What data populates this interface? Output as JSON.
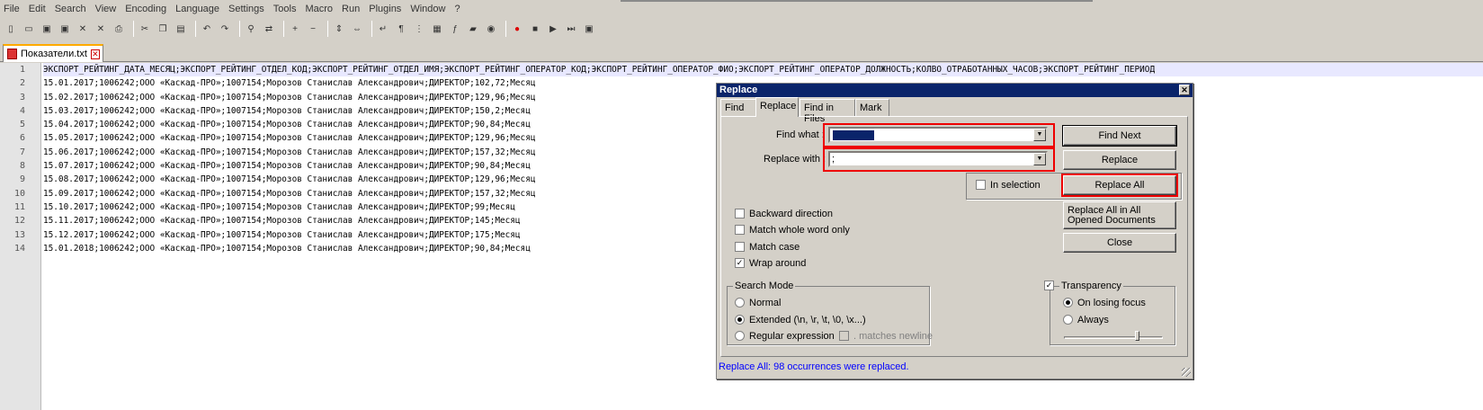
{
  "menu": [
    "File",
    "Edit",
    "Search",
    "View",
    "Encoding",
    "Language",
    "Settings",
    "Tools",
    "Macro",
    "Run",
    "Plugins",
    "Window",
    "?"
  ],
  "toolbar": {
    "icons": [
      "new-file-icon",
      "open-file-icon",
      "save-icon",
      "save-all-icon",
      "close-icon",
      "close-all-icon",
      "print-icon",
      "cut-icon",
      "copy-icon",
      "paste-icon",
      "undo-icon",
      "redo-icon",
      "find-icon",
      "replace-icon",
      "zoom-in-icon",
      "zoom-out-icon",
      "sync-v-icon",
      "sync-h-icon",
      "wrap-icon",
      "show-all-icon",
      "indent-guide-icon",
      "doc-map-icon",
      "function-list-icon",
      "folder-icon",
      "monitor-icon",
      "record-icon",
      "stop-icon",
      "play-icon",
      "run-multiple-icon",
      "save-macro-icon"
    ]
  },
  "tab": {
    "label": "Показатели.txt"
  },
  "editor": {
    "lines": [
      "ЭКСПОРТ_РЕЙТИНГ_ДАТА_МЕСЯЦ;ЭКСПОРТ_РЕЙТИНГ_ОТДЕЛ_КОД;ЭКСПОРТ_РЕЙТИНГ_ОТДЕЛ_ИМЯ;ЭКСПОРТ_РЕЙТИНГ_ОПЕРАТОР_КОД;ЭКСПОРТ_РЕЙТИНГ_ОПЕРАТОР_ФИО;ЭКСПОРТ_РЕЙТИНГ_ОПЕРАТОР_ДОЛЖНОСТЬ;КОЛВО_ОТРАБОТАННЫХ_ЧАСОВ;ЭКСПОРТ_РЕЙТИНГ_ПЕРИОД",
      "15.01.2017;1006242;ООО «Каскад-ПРО»;1007154;Морозов Станислав Александрович;ДИРЕКТОР;102,72;Месяц",
      "15.02.2017;1006242;ООО «Каскад-ПРО»;1007154;Морозов Станислав Александрович;ДИРЕКТОР;129,96;Месяц",
      "15.03.2017;1006242;ООО «Каскад-ПРО»;1007154;Морозов Станислав Александрович;ДИРЕКТОР;150,2;Месяц",
      "15.04.2017;1006242;ООО «Каскад-ПРО»;1007154;Морозов Станислав Александрович;ДИРЕКТОР;90,84;Месяц",
      "15.05.2017;1006242;ООО «Каскад-ПРО»;1007154;Морозов Станислав Александрович;ДИРЕКТОР;129,96;Месяц",
      "15.06.2017;1006242;ООО «Каскад-ПРО»;1007154;Морозов Станислав Александрович;ДИРЕКТОР;157,32;Месяц",
      "15.07.2017;1006242;ООО «Каскад-ПРО»;1007154;Морозов Станислав Александрович;ДИРЕКТОР;90,84;Месяц",
      "15.08.2017;1006242;ООО «Каскад-ПРО»;1007154;Морозов Станислав Александрович;ДИРЕКТОР;129,96;Месяц",
      "15.09.2017;1006242;ООО «Каскад-ПРО»;1007154;Морозов Станислав Александрович;ДИРЕКТОР;157,32;Месяц",
      "15.10.2017;1006242;ООО «Каскад-ПРО»;1007154;Морозов Станислав Александрович;ДИРЕКТОР;99;Месяц",
      "15.11.2017;1006242;ООО «Каскад-ПРО»;1007154;Морозов Станислав Александрович;ДИРЕКТОР;145;Месяц",
      "15.12.2017;1006242;ООО «Каскад-ПРО»;1007154;Морозов Станислав Александрович;ДИРЕКТОР;175;Месяц",
      "15.01.2018;1006242;ООО «Каскад-ПРО»;1007154;Морозов Станислав Александрович;ДИРЕКТОР;90,84;Месяц"
    ]
  },
  "dialog": {
    "title": "Replace",
    "tabs": [
      "Find",
      "Replace",
      "Find in Files",
      "Mark"
    ],
    "find_label": "Find what :",
    "replace_label": "Replace with :",
    "replace_value": ";",
    "buttons": {
      "find_next": "Find Next",
      "replace": "Replace",
      "replace_all": "Replace All",
      "replace_all_opened": "Replace All in All Opened Documents",
      "close": "Close"
    },
    "in_selection": "In selection",
    "options": {
      "backward": "Backward direction",
      "whole_word": "Match whole word only",
      "match_case": "Match case",
      "wrap": "Wrap around"
    },
    "search_mode": {
      "title": "Search Mode",
      "normal": "Normal",
      "extended": "Extended (\\n, \\r, \\t, \\0, \\x...)",
      "regex": "Regular expression",
      "matches_newline": ". matches newline"
    },
    "transparency": {
      "title": "Transparency",
      "on_losing_focus": "On losing focus",
      "always": "Always"
    },
    "status": "Replace All: 98 occurrences were replaced."
  },
  "colors": {
    "highlight_box": "#e00000",
    "selection": "#0a246a",
    "status_text": "#0000ff"
  }
}
